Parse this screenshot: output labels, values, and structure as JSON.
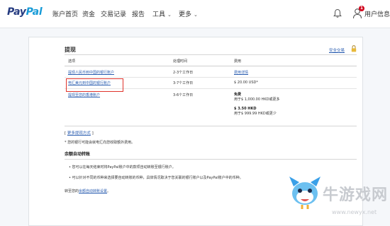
{
  "brand": {
    "part1": "Pay",
    "part2": "Pal",
    "color1": "#253b80",
    "color2": "#179bd7"
  },
  "nav": {
    "items": [
      {
        "label": "账户首页",
        "has_caret": false
      },
      {
        "label": "资金",
        "has_caret": false
      },
      {
        "label": "交易记录",
        "has_caret": false
      },
      {
        "label": "报告",
        "has_caret": false
      },
      {
        "label": "工具",
        "has_caret": true
      },
      {
        "label": "更多",
        "has_caret": true
      }
    ],
    "caret": "⌄",
    "notification_count": "1",
    "user_label": "用户信息",
    "icons": {
      "bell": "bell-icon",
      "user": "user-icon"
    }
  },
  "withdraw": {
    "title": "提现",
    "security_link": "安全交易",
    "table": {
      "headers": [
        "选项",
        "处理时间",
        "费用"
      ],
      "rows": [
        {
          "option": "提现人民币到中国的银行账户",
          "time": "2-3个工作日",
          "fee_link": "费用详情"
        },
        {
          "option": "电汇美元到中国的银行账户",
          "time": "3-7个工作日",
          "fee": "$ 20.00 USD*"
        },
        {
          "option": "提现至您的香港账户",
          "time": "3-6个工作日",
          "fee1_bold": "免费",
          "fee1_note": "用于$ 1,000.00 HKD或更多",
          "fee2_bold": "$ 3.50 HKD",
          "fee2_note": "用于$ 999.99 HKD或更少"
        }
      ]
    },
    "more_methods": {
      "open": "[",
      "link": "更多提现方式",
      "close": "]"
    },
    "bank_fee_note": "* 您的银行可能会就电汇向您收取额外费用。",
    "auto_transfer": {
      "heading": "余额自动转账",
      "bullets": [
        "您可以在每天结束时将PayPal账户中的款项自动转账至银行账户。",
        "可以针对不同的币种来选择要自动转账的币种，具体情况取决于您关联的银行账户以及PayPal账户中的币种。"
      ],
      "footer_prefix": "转至您的",
      "footer_link": "余额自动转账设置",
      "footer_suffix": "。"
    }
  },
  "watermark": {
    "text": "牛游戏网",
    "url": "www.newyx.net"
  }
}
